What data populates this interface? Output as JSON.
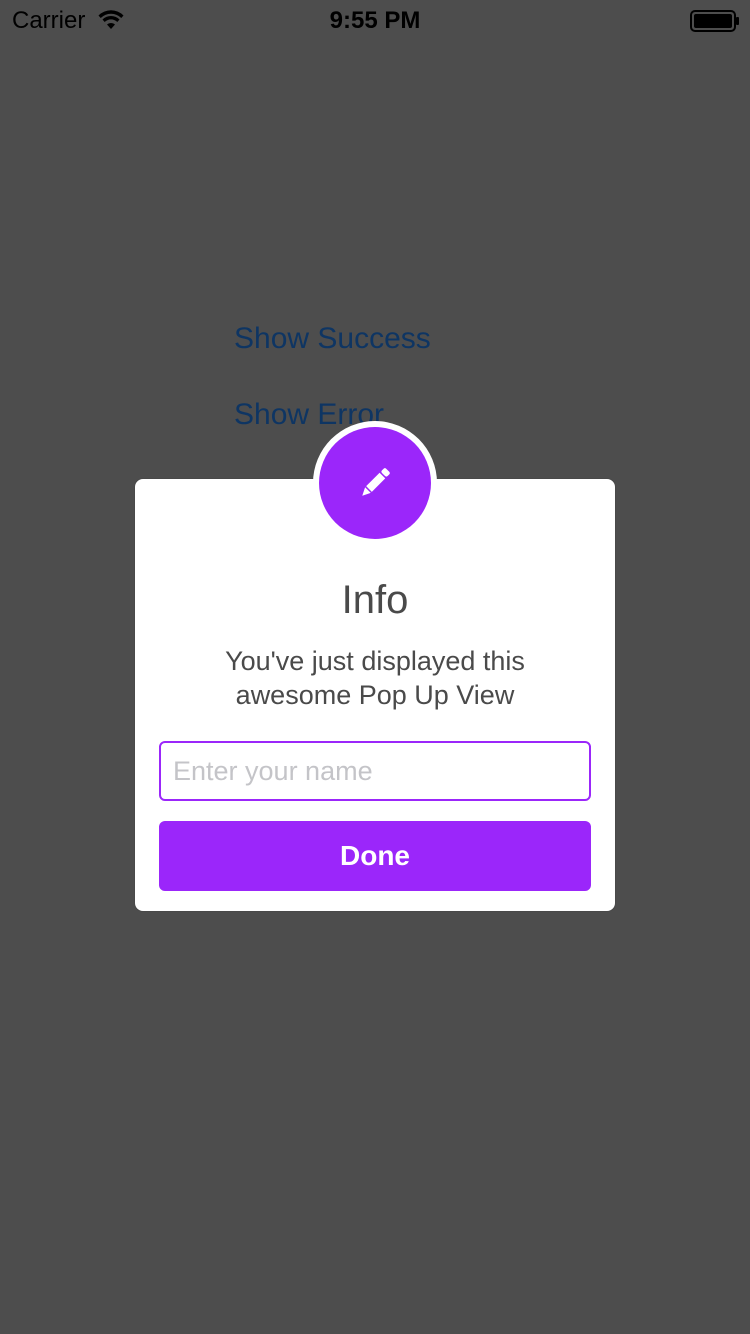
{
  "status_bar": {
    "carrier": "Carrier",
    "time": "9:55 PM"
  },
  "background": {
    "show_success_label": "Show Success",
    "show_error_label": "Show Error"
  },
  "popup": {
    "icon": "pencil-icon",
    "title": "Info",
    "message_line1": "You've just displayed this",
    "message_line2": "awesome Pop Up View",
    "input": {
      "value": "",
      "placeholder": "Enter your name"
    },
    "done_label": "Done"
  },
  "colors": {
    "background": "#4d4d4d",
    "accent": "#9b26fa",
    "link": "#0e3563",
    "text": "#4a4a4a",
    "placeholder": "#c4c4c8"
  }
}
